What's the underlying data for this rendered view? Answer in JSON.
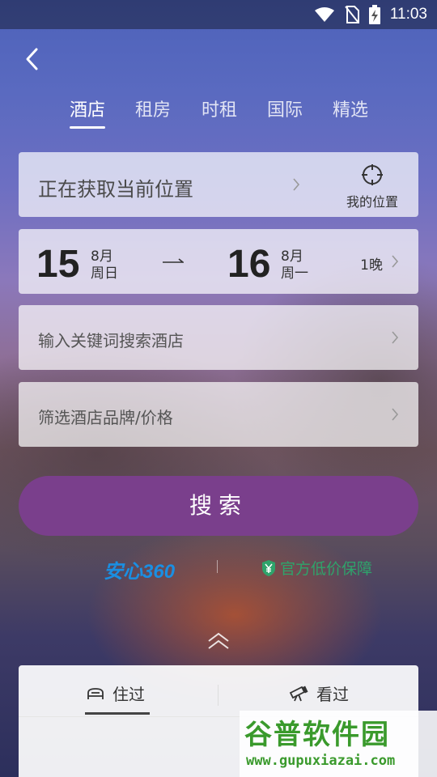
{
  "status_bar": {
    "time": "11:03",
    "icons": [
      "wifi-icon",
      "no-sim-icon",
      "battery-charging-icon"
    ]
  },
  "nav": {
    "back_icon": "chevron-left-icon"
  },
  "tabs": [
    {
      "label": "酒店",
      "active": true
    },
    {
      "label": "租房",
      "active": false
    },
    {
      "label": "时租",
      "active": false
    },
    {
      "label": "国际",
      "active": false
    },
    {
      "label": "精选",
      "active": false
    }
  ],
  "location": {
    "text": "正在获取当前位置",
    "my_location_label": "我的位置",
    "icon": "crosshair-icon"
  },
  "dates": {
    "checkin": {
      "day": "15",
      "month": "8月",
      "weekday": "周日"
    },
    "checkout": {
      "day": "16",
      "month": "8月",
      "weekday": "周一"
    },
    "nights": "1晚"
  },
  "keyword": {
    "placeholder": "输入关键词搜索酒店"
  },
  "filter": {
    "placeholder": "筛选酒店品牌/价格"
  },
  "search_button": "搜索",
  "badges": {
    "anxin": "安心360",
    "guarantee": "官方低价保障"
  },
  "history": {
    "tabs": [
      {
        "label": "住过",
        "icon": "bed-icon"
      },
      {
        "label": "看过",
        "icon": "telescope-icon"
      }
    ]
  },
  "watermark": {
    "title": "谷普软件园",
    "url": "www.gupuxiazai.com"
  },
  "colors": {
    "search_button": "#7a3f8c",
    "anxin": "#1a8fe3",
    "guarantee": "#2fa36b",
    "watermark": "#3a9a2c"
  }
}
